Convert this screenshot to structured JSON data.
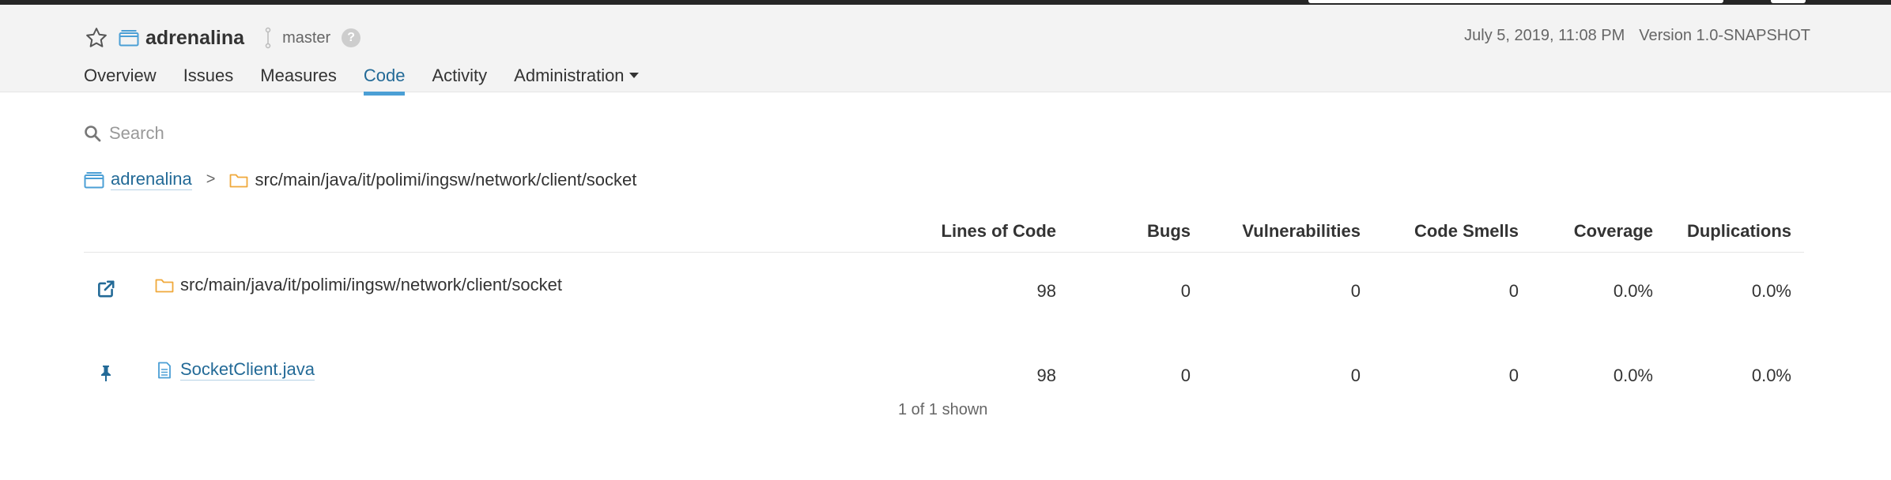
{
  "project": {
    "name": "adrenalina",
    "branch": "master",
    "help": "?"
  },
  "meta": {
    "date": "July 5, 2019, 11:08 PM",
    "version": "Version 1.0-SNAPSHOT"
  },
  "nav": {
    "items": [
      {
        "label": "Overview"
      },
      {
        "label": "Issues"
      },
      {
        "label": "Measures"
      },
      {
        "label": "Code"
      },
      {
        "label": "Activity"
      },
      {
        "label": "Administration"
      }
    ],
    "active": "Code"
  },
  "search": {
    "placeholder": "Search"
  },
  "breadcrumb": {
    "root": "adrenalina",
    "separator": ">",
    "current": "src/main/java/it/polimi/ingsw/network/client/socket"
  },
  "table": {
    "headers": {
      "loc": "Lines of Code",
      "bugs": "Bugs",
      "vulnerabilities": "Vulnerabilities",
      "code_smells": "Code Smells",
      "coverage": "Coverage",
      "duplications": "Duplications"
    },
    "rows": [
      {
        "action_icon": "external-link-icon",
        "file_icon": "folder-icon",
        "name": "src/main/java/it/polimi/ingsw/network/client/socket",
        "loc": "98",
        "bugs": "0",
        "vulnerabilities": "0",
        "code_smells": "0",
        "coverage": "0.0%",
        "duplications": "0.0%"
      },
      {
        "action_icon": "pin-icon",
        "file_icon": "file-icon",
        "name": "SocketClient.java",
        "loc": "98",
        "bugs": "0",
        "vulnerabilities": "0",
        "code_smells": "0",
        "coverage": "0.0%",
        "duplications": "0.0%"
      }
    ],
    "footer": "1 of 1 shown"
  },
  "colors": {
    "link": "#236a97",
    "active_tab": "#4b9fd5",
    "folder": "#f0a93b",
    "header_bg": "#f3f3f3"
  }
}
